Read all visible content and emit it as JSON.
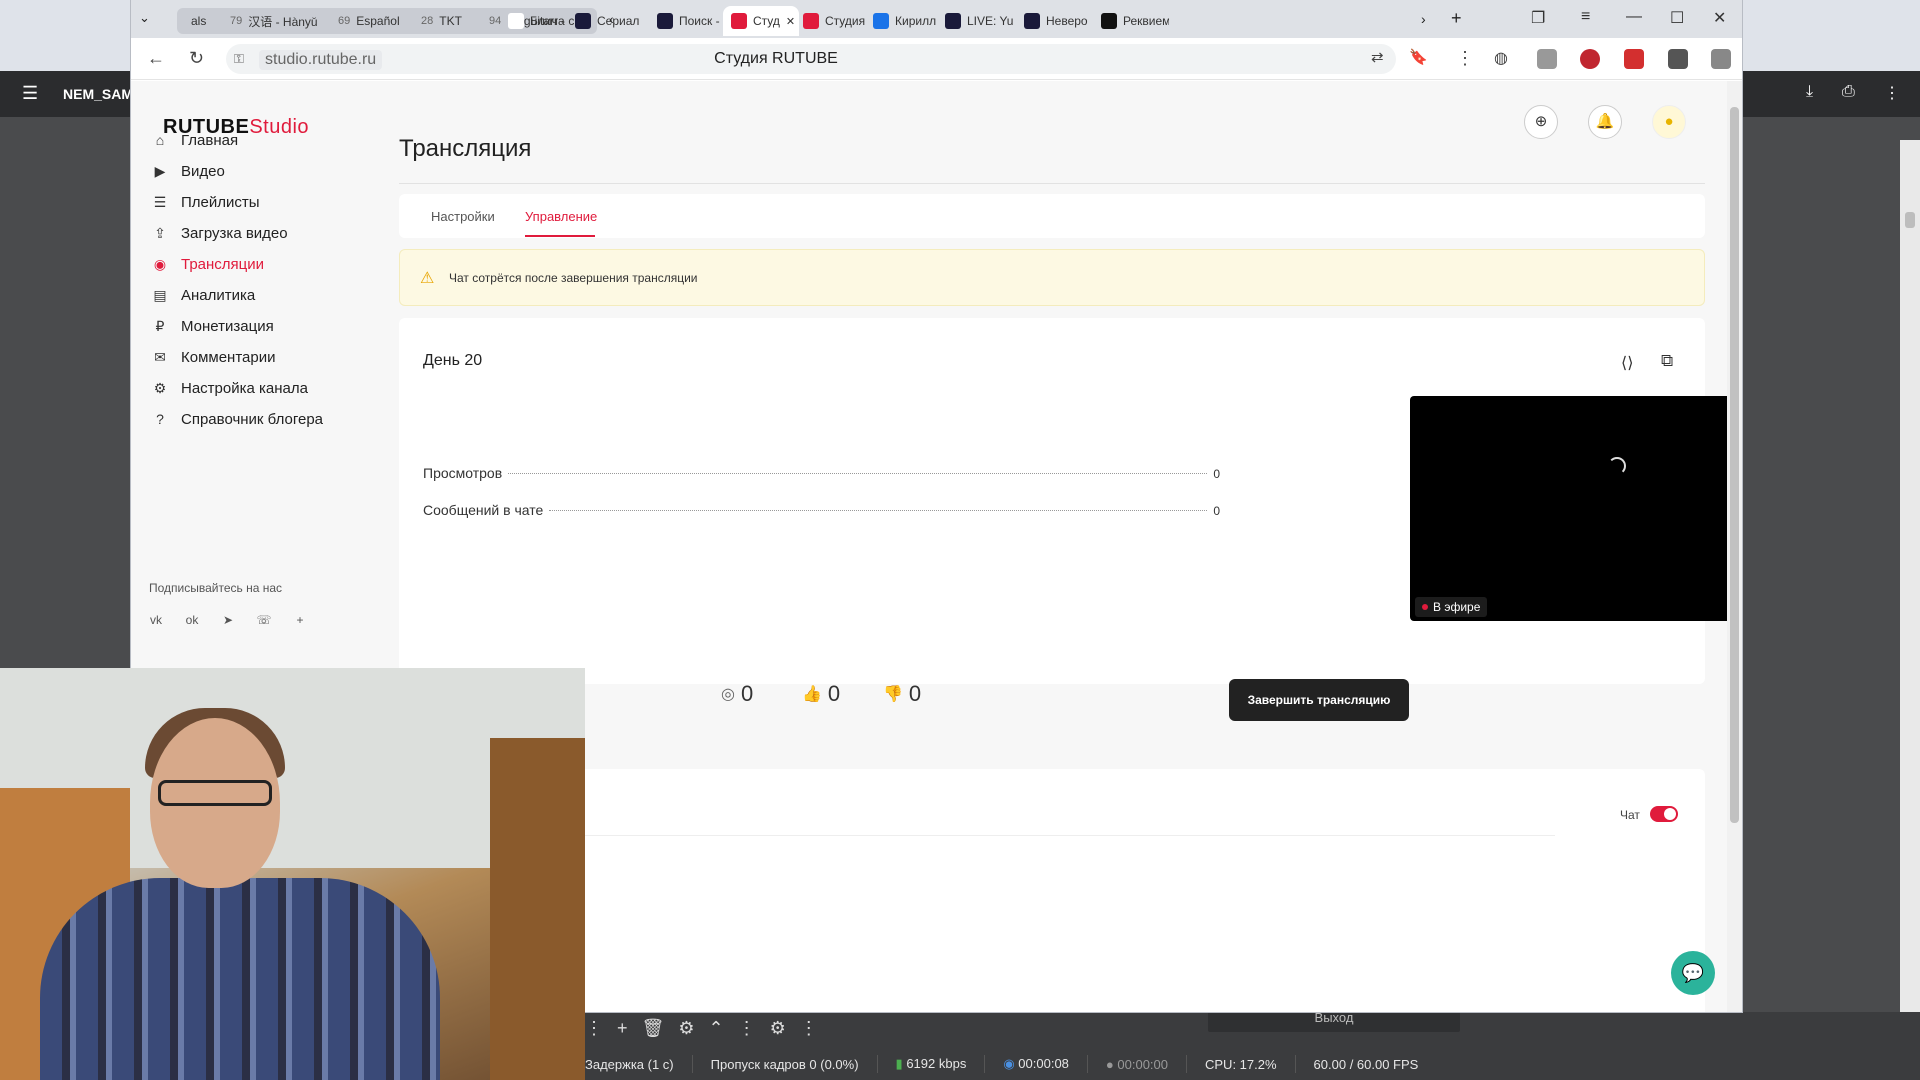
{
  "background": {
    "app_label": "NEM_SAM",
    "obs": {
      "exit_label": "Выход",
      "status": {
        "delay": "Задержка (1 с)",
        "dropped": "Пропуск кадров 0 (0.0%)",
        "bitrate": "6192 kbps",
        "stream_time": "00:00:08",
        "rec_time": "00:00:00",
        "cpu": "CPU: 17.2%",
        "fps": "60.00 / 60.00 FPS"
      }
    }
  },
  "browser": {
    "tab_group": [
      {
        "count": "",
        "label": "als"
      },
      {
        "count": "79",
        "label": "汉语 - Hànyǔ"
      },
      {
        "count": "69",
        "label": "Español"
      },
      {
        "count": "28",
        "label": "TKT"
      },
      {
        "count": "94",
        "label": "La guitarra"
      }
    ],
    "tabs": [
      {
        "label": "Блич - с",
        "color": "#ffffff"
      },
      {
        "label": "Сериал",
        "color": "#1a1a3a"
      },
      {
        "label": "Поиск -",
        "color": "#1a1a3a"
      },
      {
        "label": "Студ",
        "color": "#e01b3c",
        "active": true
      },
      {
        "label": "Студия",
        "color": "#e01b3c"
      },
      {
        "label": "Кирилл",
        "color": "#1a73e8"
      },
      {
        "label": "LIVE: Yu",
        "color": "#1a1a3a"
      },
      {
        "label": "Неверо",
        "color": "#1a1a3a"
      },
      {
        "label": "Реквием",
        "color": "#111111"
      }
    ],
    "url": "studio.rutube.ru",
    "page_title": "Студия RUTUBE"
  },
  "app": {
    "logo_main": "RUTUBE",
    "logo_studio": "Studio",
    "nav": [
      {
        "label": "Главная",
        "icon": "home-icon",
        "glyph": "⌂"
      },
      {
        "label": "Видео",
        "icon": "video-icon",
        "glyph": "▶"
      },
      {
        "label": "Плейлисты",
        "icon": "playlist-icon",
        "glyph": "☰"
      },
      {
        "label": "Загрузка видео",
        "icon": "upload-icon",
        "glyph": "⇪"
      },
      {
        "label": "Трансляции",
        "icon": "broadcast-icon",
        "glyph": "◉",
        "active": true
      },
      {
        "label": "Аналитика",
        "icon": "analytics-icon",
        "glyph": "▤"
      },
      {
        "label": "Монетизация",
        "icon": "monetization-icon",
        "glyph": "₽"
      },
      {
        "label": "Комментарии",
        "icon": "comments-icon",
        "glyph": "✉"
      },
      {
        "label": "Настройка канала",
        "icon": "settings-icon",
        "glyph": "⚙"
      },
      {
        "label": "Справочник блогера",
        "icon": "help-icon",
        "glyph": "?"
      }
    ],
    "social_title": "Подписывайтесь на нас",
    "social": [
      {
        "glyph": "vk",
        "icon": "vk-icon"
      },
      {
        "glyph": "ok",
        "icon": "odnoklassniki-icon"
      },
      {
        "glyph": "➤",
        "icon": "telegram-icon"
      },
      {
        "glyph": "☏",
        "icon": "viber-icon"
      },
      {
        "glyph": "+",
        "icon": "more-icon"
      }
    ],
    "heading": "Трансляция",
    "tabs": {
      "settings": "Настройки",
      "manage": "Управление"
    },
    "warning": "Чат сотрётся после завершения трансляции",
    "stream": {
      "title": "День 20",
      "stats": [
        {
          "label": "Просмотров",
          "value": "0"
        },
        {
          "label": "Сообщений в чате",
          "value": "0"
        }
      ],
      "live_label": "В эфире",
      "viewers": "0",
      "likes": "0",
      "dislikes": "0",
      "end_button": "Завершить трансляцию"
    },
    "chat": {
      "label": "Чат",
      "enabled": true
    },
    "accent": "#e01b3c"
  }
}
